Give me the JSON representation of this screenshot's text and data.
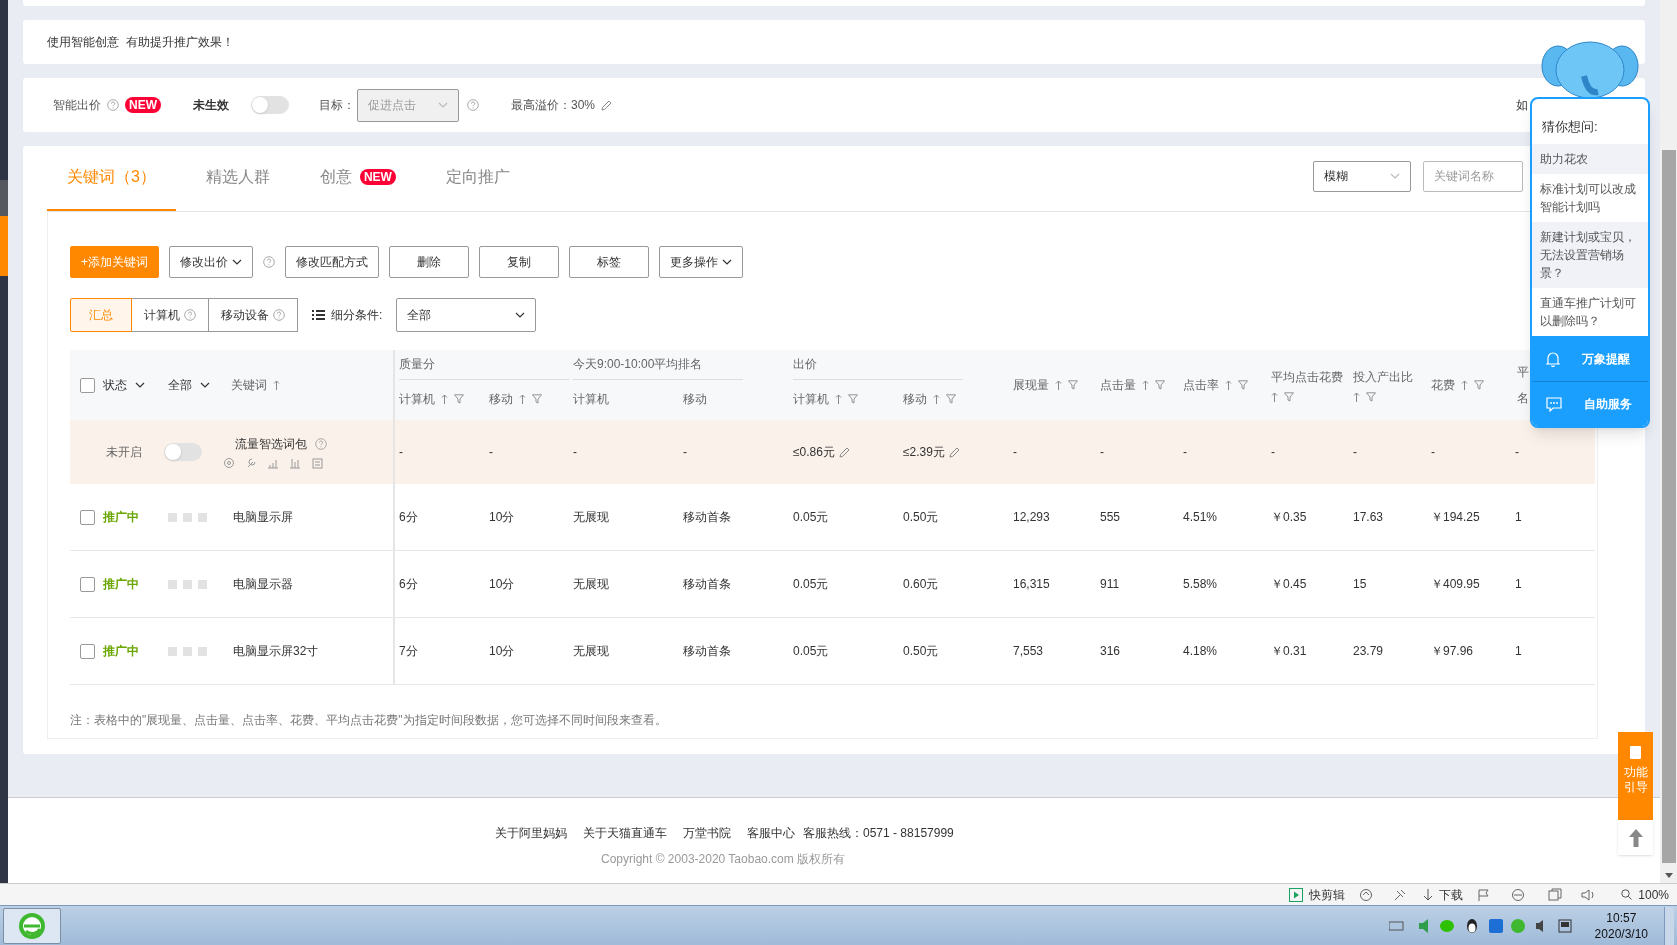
{
  "notice_card": {
    "text": "使用智能创意  有助提升推广效果！"
  },
  "smart_bid": {
    "label": "智能出价",
    "badge": "NEW",
    "status": "未生效",
    "enabled": false,
    "target_label": "目标：",
    "target_value": "促进点击",
    "max_premium": "最高溢价：30%",
    "trailing": "如"
  },
  "tabs": [
    {
      "label": "关键词（3）",
      "selected": true
    },
    {
      "label": "精选人群",
      "selected": false
    },
    {
      "label": "创意",
      "badge": "NEW",
      "selected": false
    },
    {
      "label": "定向推广",
      "selected": false
    }
  ],
  "search": {
    "match_mode": "模糊",
    "placeholder": "关键词名称"
  },
  "toolbar": [
    {
      "label": "+添加关键词",
      "kind": "primary"
    },
    {
      "label": "修改出价",
      "kind": "dropdown"
    },
    {
      "kind": "help"
    },
    {
      "label": "修改匹配方式",
      "kind": "plain"
    },
    {
      "label": "删除",
      "kind": "plain"
    },
    {
      "label": "复制",
      "kind": "plain"
    },
    {
      "label": "标签",
      "kind": "plain"
    },
    {
      "label": "更多操作",
      "kind": "dropdown"
    }
  ],
  "device_tabs": [
    {
      "label": "汇总",
      "selected": true,
      "help": false
    },
    {
      "label": "计算机",
      "selected": false,
      "help": true
    },
    {
      "label": "移动设备",
      "selected": false,
      "help": true
    }
  ],
  "filter": {
    "label": "细分条件:",
    "value": "全部"
  },
  "table": {
    "header": {
      "checked": false,
      "status": "状态",
      "all": "全部",
      "keyword": "关键词",
      "groups": [
        {
          "label": "质量分",
          "columns": [
            {
              "label": "计算机",
              "sortable": true
            },
            {
              "label": "移动",
              "sortable": true
            }
          ]
        },
        {
          "label": "今天9:00-10:00平均排名",
          "columns": [
            {
              "label": "计算机",
              "sortable": false
            },
            {
              "label": "移动",
              "sortable": false
            }
          ]
        },
        {
          "label": "出价",
          "columns": [
            {
              "label": "计算机",
              "sortable": true
            },
            {
              "label": "移动",
              "sortable": true
            }
          ]
        }
      ],
      "metrics": [
        "展现量",
        "点击量",
        "点击率",
        "平均点击花费",
        "投入产出比",
        "花费"
      ],
      "last": [
        "平",
        "名"
      ]
    },
    "package_row": {
      "status": "未开启",
      "enabled": false,
      "name": "流量智选词包",
      "quality": [
        "-",
        "-"
      ],
      "rank": [
        "-",
        "-"
      ],
      "bid": [
        "≤0.86元",
        "≤2.39元"
      ],
      "metrics": [
        "-",
        "-",
        "-",
        "-",
        "-",
        "-"
      ],
      "last": "-"
    },
    "rows": [
      {
        "checked": false,
        "status": "推广中",
        "keyword": "电脑显示屏",
        "quality": [
          "6分",
          "10分"
        ],
        "rank": [
          "无展现",
          "移动首条"
        ],
        "bid": [
          "0.05元",
          "0.50元"
        ],
        "metrics": [
          "12,293",
          "555",
          "4.51%",
          "￥0.35",
          "17.63",
          "￥194.25"
        ],
        "last": "1"
      },
      {
        "checked": false,
        "status": "推广中",
        "keyword": "电脑显示器",
        "quality": [
          "6分",
          "10分"
        ],
        "rank": [
          "无展现",
          "移动首条"
        ],
        "bid": [
          "0.05元",
          "0.60元"
        ],
        "metrics": [
          "16,315",
          "911",
          "5.58%",
          "￥0.45",
          "15",
          "￥409.95"
        ],
        "last": "1"
      },
      {
        "checked": false,
        "status": "推广中",
        "keyword": "电脑显示屏32寸",
        "quality": [
          "7分",
          "10分"
        ],
        "rank": [
          "无展现",
          "移动首条"
        ],
        "bid": [
          "0.05元",
          "0.50元"
        ],
        "metrics": [
          "7,553",
          "316",
          "4.18%",
          "￥0.31",
          "23.79",
          "￥97.96"
        ],
        "last": "1"
      }
    ]
  },
  "note": "注：表格中的\"展现量、点击量、点击率、花费、平均点击花费\"为指定时间段数据，您可选择不同时间段来查看。",
  "footer": {
    "links": [
      "关于阿里妈妈",
      "关于天猫直通车",
      "万堂书院",
      "客服中心"
    ],
    "hotline": "客服热线：0571 - 88157999",
    "copyright": "Copyright © 2003-2020 Taobao.com 版权所有"
  },
  "assistant": {
    "title": "猜你想问:",
    "questions": [
      {
        "text": "助力花农",
        "highlighted": true
      },
      {
        "text": "标准计划可以改成智能计划吗",
        "highlighted": false
      },
      {
        "text": "新建计划或宝贝，无法设置营销场景？",
        "highlighted": true
      },
      {
        "text": "直通车推广计划可以删除吗？",
        "highlighted": false
      }
    ],
    "actions": [
      {
        "label": "万象提醒",
        "kind": "bell"
      },
      {
        "label": "自助服务",
        "kind": "chat"
      }
    ]
  },
  "guide_button": "功能引导",
  "browser_status": {
    "items": [
      {
        "label": "快剪辑",
        "kind": "clip"
      },
      {
        "label": "下载",
        "kind": "download"
      }
    ],
    "zoom": "100%"
  },
  "taskbar": {
    "time": "10:57",
    "date": "2020/3/10"
  }
}
